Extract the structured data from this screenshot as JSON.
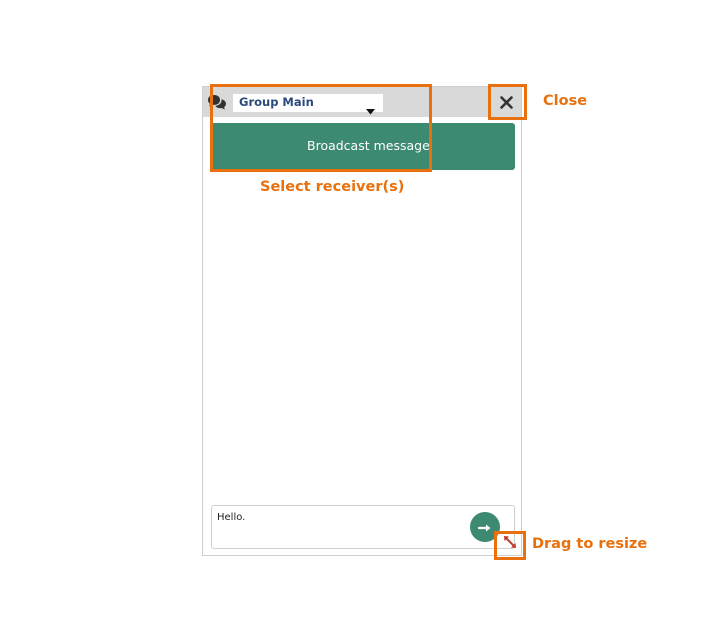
{
  "chat": {
    "receiver_selected": "Group Main",
    "broadcast_label": "Broadcast message",
    "message_value": "Hello."
  },
  "annotations": {
    "close": "Close",
    "receiver": "Select receiver(s)",
    "resize": "Drag to resize"
  },
  "icons": {
    "header": "chat-bubbles-icon",
    "dropdown": "caret-down-icon",
    "close": "close-x-icon",
    "send": "arrow-right-icon",
    "resize": "diagonal-resize-icon"
  },
  "colors": {
    "accent": "#3d8a72",
    "annotation": "#e8700e",
    "header_bg": "#d9d9d9",
    "receiver_text": "#2a4a7a",
    "resize_icon": "#c0392b"
  }
}
